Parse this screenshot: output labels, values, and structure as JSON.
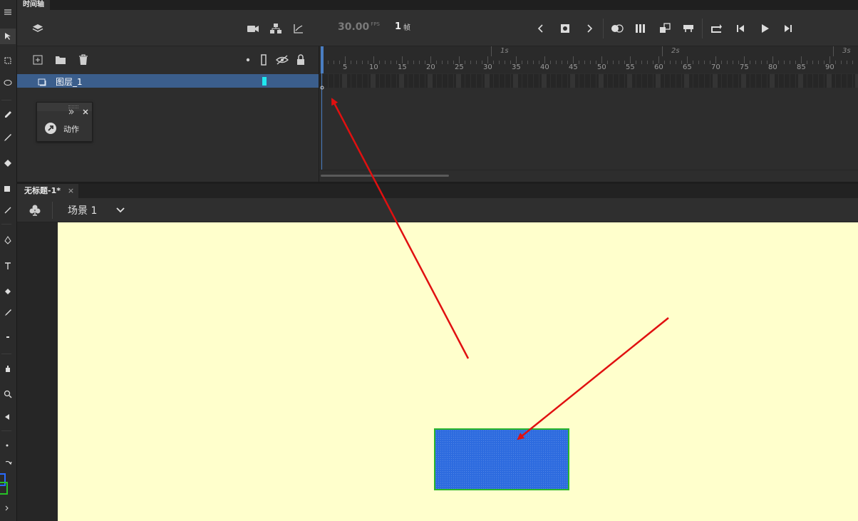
{
  "timeline": {
    "tab_label": "时间轴",
    "fps_value": "30.00",
    "fps_unit": "FPS",
    "current_frame": "1",
    "frame_unit": "帧",
    "second_marks": [
      "1s",
      "2s",
      "3s"
    ],
    "frame_ticks": [
      "5",
      "10",
      "15",
      "20",
      "25",
      "30",
      "35",
      "40",
      "45",
      "50",
      "55",
      "60",
      "65",
      "70",
      "75",
      "80",
      "85",
      "90"
    ],
    "layer": {
      "name": "图层_1",
      "color": "#20e8f0"
    }
  },
  "actions_panel": {
    "label": "动作"
  },
  "document": {
    "tab_title": "无标题-1*",
    "close_glyph": "×",
    "scene_label": "场景 1",
    "stage_color": "#ffffcc",
    "shape_fill": "#2d6bdf",
    "shape_stroke": "#2ab52a"
  },
  "annotations": {
    "arrow_color": "#e01010"
  }
}
